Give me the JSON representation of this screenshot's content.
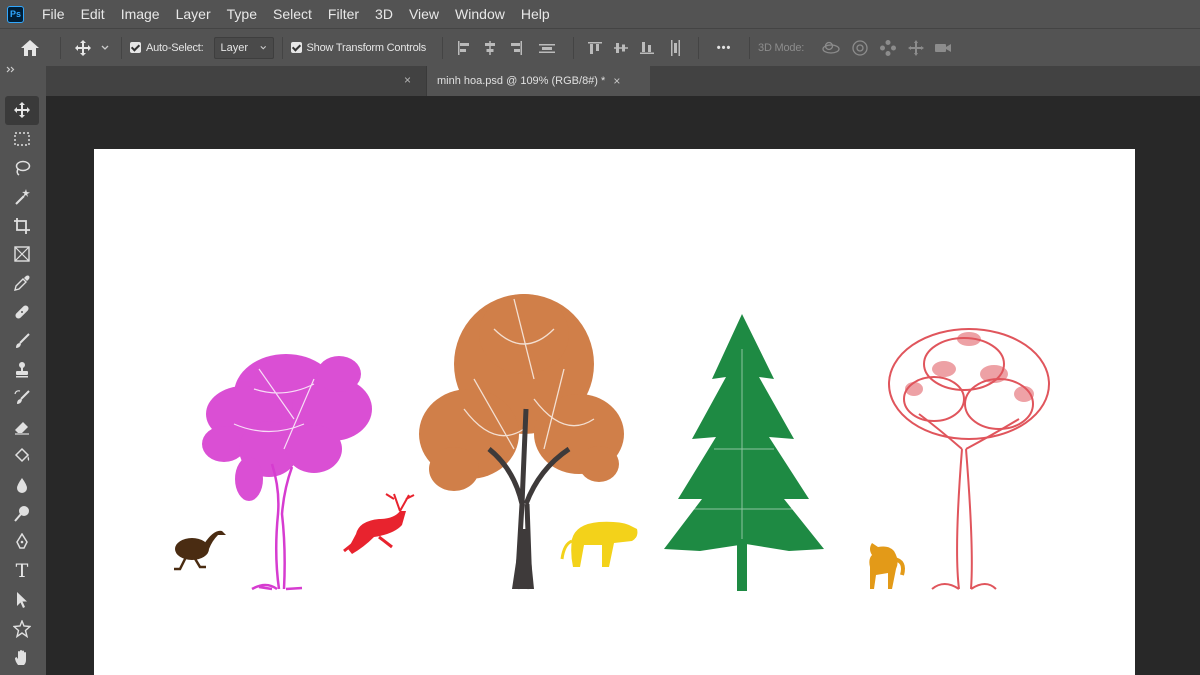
{
  "app": {
    "logo_text": "Ps"
  },
  "menu": [
    "File",
    "Edit",
    "Image",
    "Layer",
    "Type",
    "Select",
    "Filter",
    "3D",
    "View",
    "Window",
    "Help"
  ],
  "options_bar": {
    "auto_select_label": "Auto-Select:",
    "auto_select_checked": true,
    "target_value": "Layer",
    "show_transform_label": "Show Transform Controls",
    "show_transform_checked": true,
    "more_label": "•••",
    "mode_3d_label": "3D Mode:"
  },
  "document_tab": {
    "title": "minh hoa.psd @ 109% (RGB/8#) *",
    "close": "×",
    "empty_close": "×"
  },
  "tools": [
    "move-tool",
    "marquee-tool",
    "lasso-tool",
    "magic-wand-tool",
    "crop-tool",
    "frame-tool",
    "eyedropper-tool",
    "healing-brush-tool",
    "brush-tool",
    "clone-stamp-tool",
    "history-brush-tool",
    "eraser-tool",
    "paint-bucket-tool",
    "blur-tool",
    "dodge-tool",
    "pen-tool",
    "type-tool",
    "path-selection-tool",
    "shape-tool",
    "hand-tool"
  ],
  "tool_text": {
    "type_tool": "T"
  },
  "artwork": {
    "colors": {
      "magenta_tree": "#d63cd0",
      "orange_tree": "#c8692a",
      "trunk": "#3e3a3a",
      "green_tree": "#1e8a43",
      "red_tree": "#e0555c",
      "ostrich": "#4a2c12",
      "deer": "#e8232e",
      "tiger": "#f3d21a",
      "fox": "#e39a18"
    }
  }
}
